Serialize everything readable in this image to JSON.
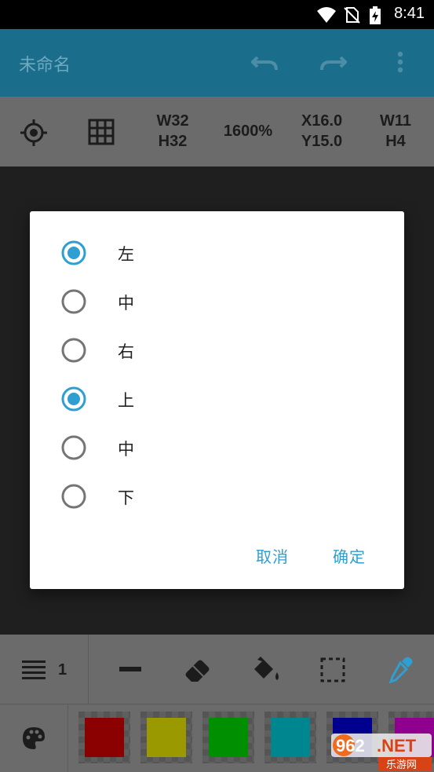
{
  "status_bar": {
    "time": "8:41",
    "icons": [
      "wifi-icon",
      "no-sim-icon",
      "battery-charging-icon"
    ]
  },
  "app_bar": {
    "title": "未命名",
    "actions": [
      "undo-icon",
      "redo-icon",
      "more-vert-icon"
    ]
  },
  "toolbar": {
    "size": {
      "w": "W32",
      "h": "H32"
    },
    "zoom": "1600%",
    "cursor": {
      "x": "X16.0",
      "y": "Y15.0"
    },
    "selection": {
      "w": "W11",
      "h": "H4"
    },
    "icons": [
      "crosshair-icon",
      "grid-icon"
    ]
  },
  "dialog": {
    "options": [
      {
        "label": "左",
        "checked": true
      },
      {
        "label": "中",
        "checked": false
      },
      {
        "label": "右",
        "checked": false
      },
      {
        "label": "上",
        "checked": true
      },
      {
        "label": "中",
        "checked": false
      },
      {
        "label": "下",
        "checked": false
      }
    ],
    "cancel_label": "取消",
    "ok_label": "确定"
  },
  "bottom_tools": {
    "stroke_count": "1",
    "tools": [
      "line-width-icon",
      "line-tool-icon",
      "eraser-icon",
      "fill-bucket-icon",
      "selection-icon",
      "eyedropper-icon"
    ]
  },
  "palette": {
    "swatches": [
      "#8b0000",
      "#9a9a00",
      "#008f00",
      "#00868f",
      "#00008f",
      "#8f008f"
    ]
  },
  "watermark": {
    "brand": "962.NET",
    "sub": "乐游网"
  },
  "colors": {
    "accent": "#2e9fd0",
    "app_bar": "#1b6e8b",
    "toolbar": "#6b6b6b"
  }
}
